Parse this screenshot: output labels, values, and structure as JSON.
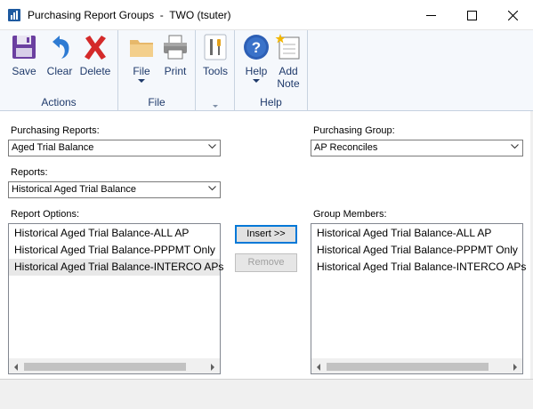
{
  "window": {
    "title": "Purchasing Report Groups  -  TWO (tsuter)"
  },
  "ribbon": {
    "groups": [
      {
        "label": "Actions"
      },
      {
        "label": "File"
      },
      {
        "label": ""
      },
      {
        "label": "Help"
      }
    ],
    "buttons": {
      "save": "Save",
      "clear": "Clear",
      "delete": "Delete",
      "file": "File",
      "print": "Print",
      "tools": "Tools",
      "help": "Help",
      "add_note_line1": "Add",
      "add_note_line2": "Note"
    },
    "icons": {
      "save": "floppy-disk-icon",
      "clear": "undo-arrow-icon",
      "delete": "red-x-icon",
      "file": "folder-icon",
      "print": "printer-icon",
      "tools": "tools-icon",
      "help": "help-question-icon",
      "add_note": "sticky-note-icon"
    }
  },
  "form": {
    "purchasing_reports_label": "Purchasing Reports:",
    "purchasing_reports_value": "Aged Trial Balance",
    "purchasing_group_label": "Purchasing Group:",
    "purchasing_group_value": "AP Reconciles",
    "reports_label": "Reports:",
    "reports_value": "Historical Aged Trial Balance",
    "report_options_label": "Report Options:",
    "group_members_label": "Group Members:",
    "report_options": [
      "Historical Aged Trial Balance-ALL AP",
      "Historical Aged Trial Balance-PPPMT Only",
      "Historical Aged Trial Balance-INTERCO APs"
    ],
    "group_members": [
      "Historical Aged Trial Balance-ALL AP",
      "Historical Aged Trial Balance-PPPMT Only",
      "Historical Aged Trial Balance-INTERCO APs"
    ],
    "insert_button": "Insert >>",
    "remove_button": "Remove"
  },
  "colors": {
    "ribbon_bg": "#f5f8fc",
    "ribbon_text": "#1f3a6b",
    "selection": "#e8e8e8",
    "focus_blue": "#0078d7"
  }
}
